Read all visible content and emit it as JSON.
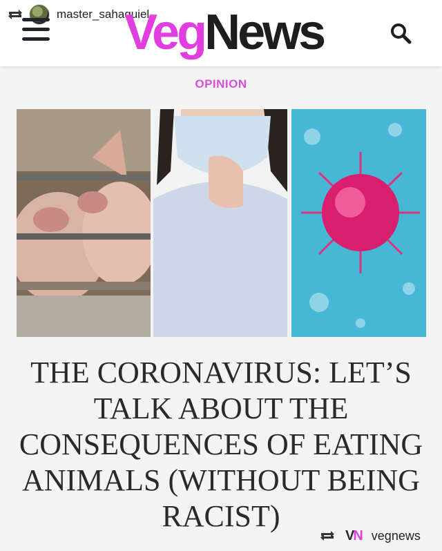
{
  "repost": {
    "username": "master_sahaquiel",
    "source_name": "vegnews"
  },
  "header": {
    "logo_part1": "Veg",
    "logo_part2": "News",
    "brand_pink": "#e03ee0"
  },
  "article": {
    "category": "OPINION",
    "headline": "THE CORONAVIRUS: LET’S TALK ABOUT THE CONSEQUENCES OF EATING ANIMALS (WITHOUT BEING RACIST)"
  },
  "vn_mark": {
    "v": "V",
    "n": "N"
  },
  "icons": [
    "repost-icon",
    "hamburger-menu-icon",
    "search-icon",
    "vegnews-logo"
  ]
}
